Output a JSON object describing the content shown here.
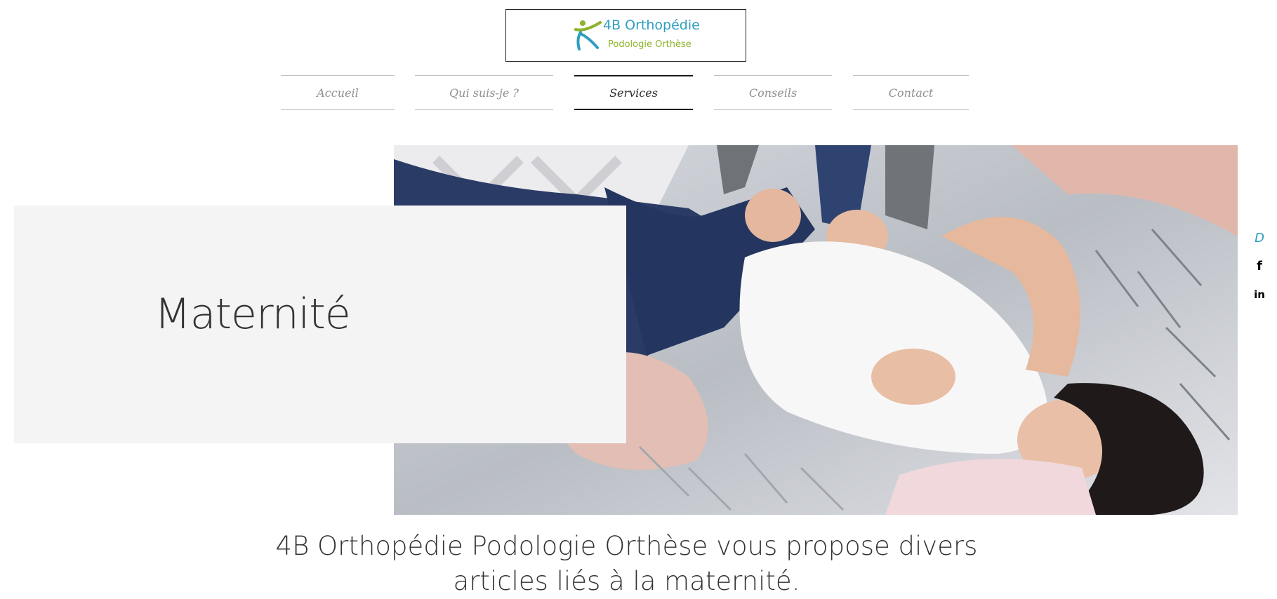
{
  "header": {
    "logo": {
      "title": "4B Orthopédie",
      "subtitle": "Podologie Orthèse",
      "colors": {
        "title": "#2e9ec0",
        "subtitle": "#8cb42a",
        "figure_green": "#8cb42a",
        "figure_blue": "#2e9ec0"
      }
    }
  },
  "nav": {
    "items": [
      {
        "label": "Accueil"
      },
      {
        "label": "Qui suis-je ?"
      },
      {
        "label": "Services",
        "active": true
      },
      {
        "label": "Conseils"
      },
      {
        "label": "Contact"
      }
    ]
  },
  "hero": {
    "title": "Maternité",
    "image_icon": "hero-photo"
  },
  "social": {
    "items": [
      {
        "icon": "podologue-icon",
        "glyph": "D"
      },
      {
        "icon": "facebook-icon",
        "glyph": "f"
      },
      {
        "icon": "linkedin-icon",
        "glyph": "in"
      }
    ]
  },
  "content": {
    "intro": "4B Orthopédie Podologie Orthèse vous propose divers articles liés à la maternité."
  }
}
